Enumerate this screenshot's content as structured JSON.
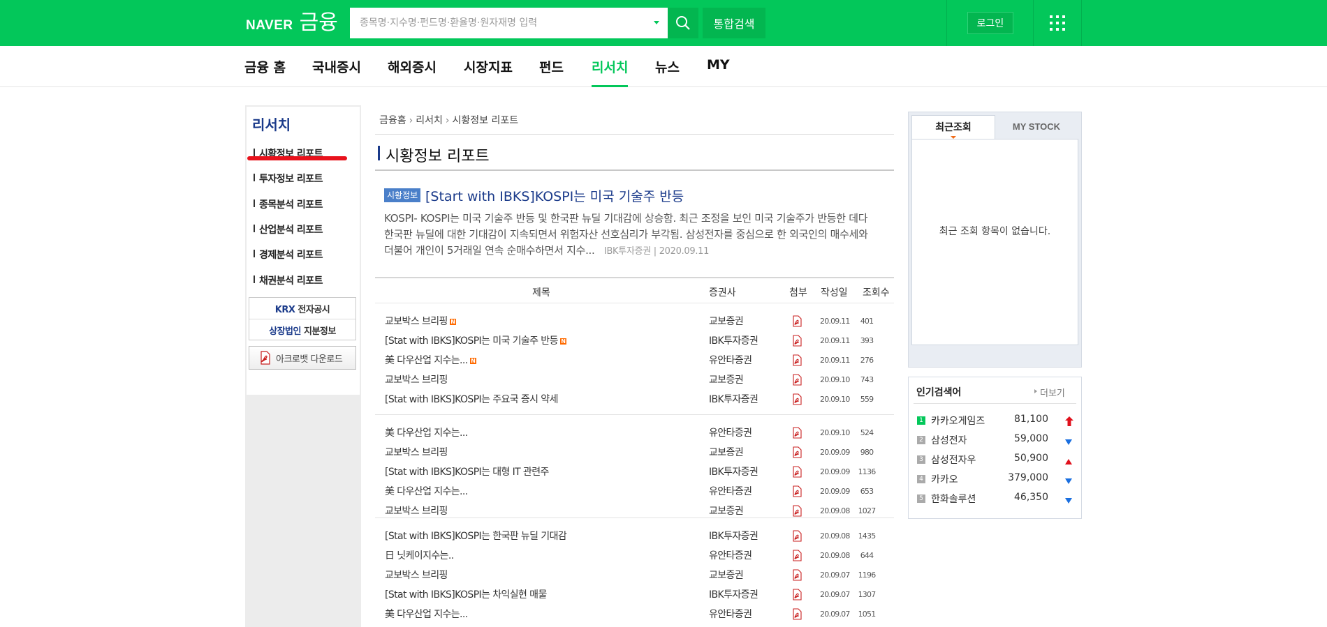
{
  "header": {
    "brand": "NAVER",
    "service": "금융",
    "search_placeholder": "종목명·지수명·펀드명·환율명·원자재명 입력",
    "total_search_label": "통합검색",
    "login_label": "로그인"
  },
  "gnb": {
    "items": [
      "금융 홈",
      "국내증시",
      "해외증시",
      "시장지표",
      "펀드",
      "리서치",
      "뉴스",
      "MY"
    ],
    "active_index": 5,
    "accent_color": "#03c75a"
  },
  "sidebar": {
    "title": "리서치",
    "items": [
      "시황정보 리포트",
      "투자정보 리포트",
      "종목분석 리포트",
      "산업분석 리포트",
      "경제분석 리포트",
      "채권분석 리포트"
    ],
    "links": [
      {
        "bold": "KRX",
        "rest": " 전자공시"
      },
      {
        "bold": "상장법인",
        "rest": " 지분정보"
      }
    ],
    "acrobat_label": "아크로뱃 다운로드"
  },
  "breadcrumb": [
    "금융홈",
    "리서치",
    "시황정보 리포트"
  ],
  "page_title": "시황정보 리포트",
  "featured": {
    "badge": "시황정보",
    "title": "[Start with IBKS]KOSPI는 미국 기술주 반등",
    "description": "KOSPI- KOSPI는 미국 기술주 반등 및 한국판 뉴딜 기대감에 상승함. 최근 조정을 보인 미국 기술주가 반등한 데다 한국판 뉴딜에 대한 기대감이 지속되면서 위험자산 선호심리가 부각됨. 삼성전자를 중심으로 한 외국인의 매수세와 더불어 개인이 5거래일 연속 순매수하면서 지수...",
    "broker": "IBK투자증권",
    "date": "2020.09.11"
  },
  "table": {
    "headers": [
      "제목",
      "증권사",
      "첨부",
      "작성일",
      "조회수"
    ],
    "rows": [
      {
        "title": "교보박스 브리핑",
        "new": true,
        "broker": "교보증권",
        "date": "20.09.11",
        "views": "401"
      },
      {
        "title": "[Stat with IBKS]KOSPI는 미국 기술주 반등",
        "new": true,
        "broker": "IBK투자증권",
        "date": "20.09.11",
        "views": "393"
      },
      {
        "title": "美 다우산업 지수는...",
        "new": true,
        "broker": "유안타증권",
        "date": "20.09.11",
        "views": "276"
      },
      {
        "title": "교보박스 브리핑",
        "new": false,
        "broker": "교보증권",
        "date": "20.09.10",
        "views": "743"
      },
      {
        "title": "[Stat with IBKS]KOSPI는 주요국 증시 약세",
        "new": false,
        "broker": "IBK투자증권",
        "date": "20.09.10",
        "views": "559"
      },
      {
        "title": "美 다우산업 지수는...",
        "new": false,
        "broker": "유안타증권",
        "date": "20.09.10",
        "views": "524"
      },
      {
        "title": "교보박스 브리핑",
        "new": false,
        "broker": "교보증권",
        "date": "20.09.09",
        "views": "980"
      },
      {
        "title": "[Stat with IBKS]KOSPI는 대형 IT 관련주",
        "new": false,
        "broker": "IBK투자증권",
        "date": "20.09.09",
        "views": "1136"
      },
      {
        "title": "美 다우산업 지수는...",
        "new": false,
        "broker": "유안타증권",
        "date": "20.09.09",
        "views": "653"
      },
      {
        "title": "교보박스 브리핑",
        "new": false,
        "broker": "교보증권",
        "date": "20.09.08",
        "views": "1027"
      },
      {
        "title": "[Stat with IBKS]KOSPI는 한국판 뉴딜 기대감",
        "new": false,
        "broker": "IBK투자증권",
        "date": "20.09.08",
        "views": "1435"
      },
      {
        "title": "日 닛케이지수는..",
        "new": false,
        "broker": "유안타증권",
        "date": "20.09.08",
        "views": "644"
      },
      {
        "title": "교보박스 브리핑",
        "new": false,
        "broker": "교보증권",
        "date": "20.09.07",
        "views": "1196"
      },
      {
        "title": "[Stat with IBKS]KOSPI는 차익실현 매물",
        "new": false,
        "broker": "IBK투자증권",
        "date": "20.09.07",
        "views": "1307"
      },
      {
        "title": "美 다우산업 지수는...",
        "new": false,
        "broker": "유안타증권",
        "date": "20.09.07",
        "views": "1051"
      }
    ]
  },
  "recent": {
    "tabs": [
      "최근조회",
      "MY STOCK"
    ],
    "empty_text": "최근 조회 항목이 없습니다."
  },
  "popular": {
    "title": "인기검색어",
    "more_label": "더보기",
    "items": [
      {
        "rank": "1",
        "name": "카카오게임즈",
        "price": "81,100",
        "trend": "upper-limit"
      },
      {
        "rank": "2",
        "name": "삼성전자",
        "price": "59,000",
        "trend": "down"
      },
      {
        "rank": "3",
        "name": "삼성전자우",
        "price": "50,900",
        "trend": "up"
      },
      {
        "rank": "4",
        "name": "카카오",
        "price": "379,000",
        "trend": "down"
      },
      {
        "rank": "5",
        "name": "한화솔루션",
        "price": "46,350",
        "trend": "down"
      }
    ],
    "up_color": "#e0101c",
    "down_color": "#1a6fe0"
  }
}
